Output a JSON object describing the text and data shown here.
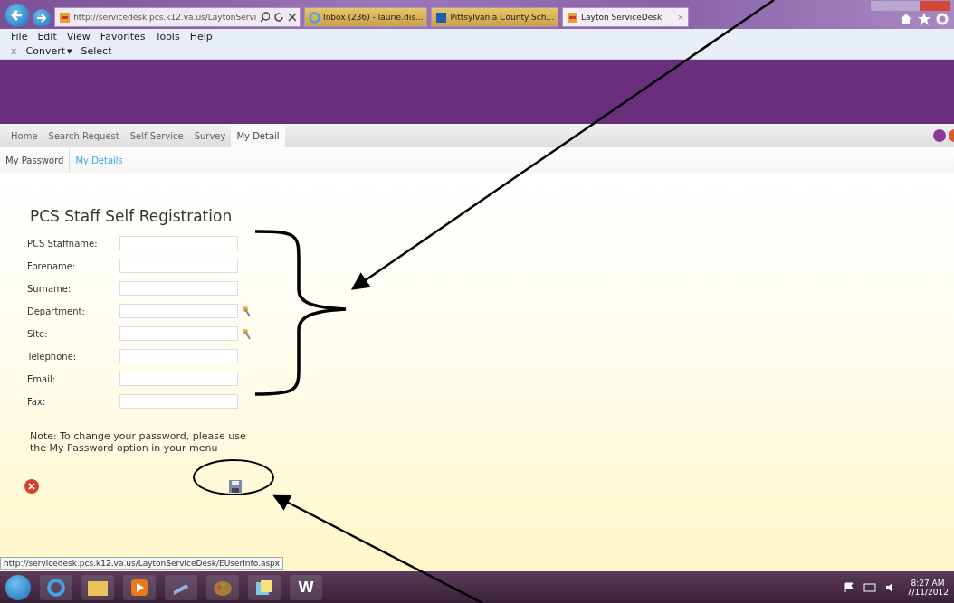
{
  "browser": {
    "address": "http://servicedesk.pcs.k12.va.us/LaytonServi",
    "tabs": [
      {
        "label": "Inbox (236) - laurie.dis...",
        "selected": false,
        "kind": "ie"
      },
      {
        "label": "Pittsylvania County Sch...",
        "selected": false,
        "kind": "calendar"
      },
      {
        "label": "Layton ServiceDesk",
        "selected": true,
        "kind": "lsd",
        "close": "×"
      }
    ],
    "menu": [
      "File",
      "Edit",
      "View",
      "Favorites",
      "Tools",
      "Help"
    ],
    "command_bar": {
      "close": "x",
      "convert": "Convert",
      "convert_caret": "▾",
      "select": "Select"
    }
  },
  "nav": [
    {
      "label": "Home",
      "selected": false
    },
    {
      "label": "Search Request",
      "selected": false
    },
    {
      "label": "Self Service",
      "selected": false
    },
    {
      "label": "Survey",
      "selected": false
    },
    {
      "label": "My Detail",
      "selected": true
    }
  ],
  "subnav": [
    {
      "label": "My Password",
      "selected": false
    },
    {
      "label": "My Details",
      "selected": true
    }
  ],
  "form": {
    "title": "PCS Staff Self Registration",
    "fields": [
      {
        "label": "PCS Staffname:",
        "lookup": false
      },
      {
        "label": "Forename:",
        "lookup": false
      },
      {
        "label": "Surname:",
        "lookup": false
      },
      {
        "label": "Department:",
        "lookup": true
      },
      {
        "label": "Site:",
        "lookup": true
      },
      {
        "label": "Telephone:",
        "lookup": false
      },
      {
        "label": "Email:",
        "lookup": false
      },
      {
        "label": "Fax:",
        "lookup": false
      }
    ],
    "note": "Note: To change your password, please use the My Password option in your menu"
  },
  "status_url": "http://servicedesk.pcs.k12.va.us/LaytonServiceDesk/EUserInfo.aspx",
  "taskbar": {
    "apps": [
      {
        "kind": "ie"
      },
      {
        "kind": "folder"
      },
      {
        "kind": "media"
      },
      {
        "kind": "scanner"
      },
      {
        "kind": "paint"
      },
      {
        "kind": "notes"
      },
      {
        "kind": "word",
        "letter": "W"
      }
    ],
    "time": "8:27 AM",
    "date": "7/11/2012"
  }
}
